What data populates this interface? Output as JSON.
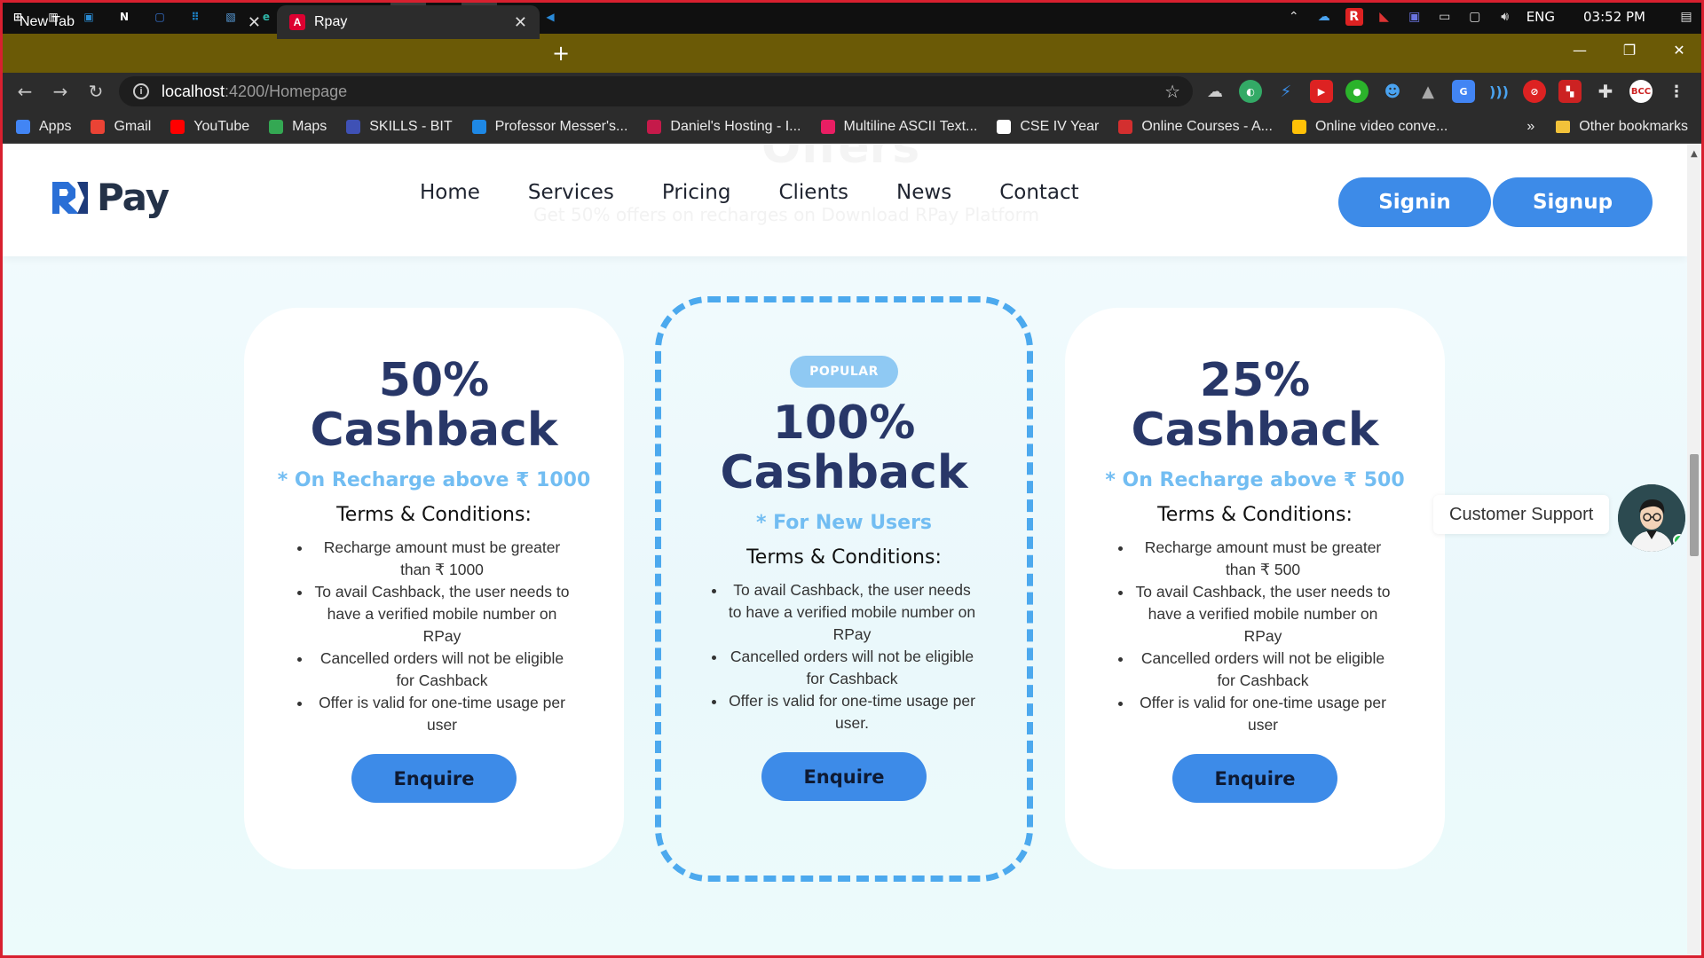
{
  "taskbar": {
    "apps": [
      {
        "name": "windows-start-icon",
        "glyph": "⊞",
        "color": "#ffffff"
      },
      {
        "name": "task-view-icon",
        "glyph": "▥",
        "color": "#ffffff"
      },
      {
        "name": "app-icon-1",
        "glyph": "▣",
        "color": "#2a8cd4"
      },
      {
        "name": "app-icon-2",
        "glyph": "N",
        "color": "#ffffff"
      },
      {
        "name": "app-icon-3",
        "glyph": "▢",
        "color": "#3a7be0"
      },
      {
        "name": "app-icon-4",
        "glyph": "⠿",
        "color": "#1c7ec0"
      },
      {
        "name": "photos-icon",
        "glyph": "▧",
        "color": "#5aa1e0"
      },
      {
        "name": "edge-icon",
        "glyph": "e",
        "color": "#2fb5a8"
      },
      {
        "name": "app-icon-5",
        "glyph": "◣",
        "color": "#d33"
      },
      {
        "name": "visual-studio-icon",
        "glyph": "◆",
        "color": "#8a52c8"
      },
      {
        "name": "file-explorer-icon",
        "glyph": "▬",
        "color": "#f2c23a"
      },
      {
        "name": "teams-icon",
        "glyph": "T",
        "color": "#5059c9"
      },
      {
        "name": "visual-studio-icon-2",
        "glyph": "◆",
        "color": "#8a52c8"
      },
      {
        "name": "chrome-icon",
        "glyph": "●",
        "color": "#f4b400"
      },
      {
        "name": "photoshop-icon",
        "glyph": "Ps",
        "color": "#1b3b5a"
      },
      {
        "name": "vscode-icon",
        "glyph": "◀",
        "color": "#2a8ad8"
      }
    ],
    "tray": {
      "language": "ENG",
      "time": "03:52 PM"
    }
  },
  "browser": {
    "tabs": [
      {
        "label": "New Tab"
      },
      {
        "label": "Rpay"
      }
    ],
    "url_host": "localhost",
    "url_path": ":4200/Homepage",
    "bookmarks": [
      {
        "label": "Apps",
        "icon": "apps-grid-icon",
        "color": "#4285f4"
      },
      {
        "label": "Gmail",
        "icon": "gmail-icon",
        "color": "#ea4335"
      },
      {
        "label": "YouTube",
        "icon": "youtube-icon",
        "color": "#ff0000"
      },
      {
        "label": "Maps",
        "icon": "maps-icon",
        "color": "#34a853"
      },
      {
        "label": "SKILLS - BIT",
        "icon": "skills-icon",
        "color": "#3f51b5"
      },
      {
        "label": "Professor Messer's...",
        "icon": "professor-messer-icon",
        "color": "#1e88e5"
      },
      {
        "label": "Daniel's Hosting - I...",
        "icon": "raspberry-icon",
        "color": "#c51a4a"
      },
      {
        "label": "Multiline ASCII Text...",
        "icon": "ascii-icon",
        "color": "#e91e63"
      },
      {
        "label": "CSE IV Year",
        "icon": "google-icon",
        "color": "#ffffff"
      },
      {
        "label": "Online Courses - A...",
        "icon": "courses-icon",
        "color": "#d32f2f"
      },
      {
        "label": "Online video conve...",
        "icon": "video-convert-icon",
        "color": "#ffc107"
      }
    ],
    "other_bookmarks": "Other bookmarks"
  },
  "site": {
    "logo_text": "Pay",
    "ghost_title": "Offers",
    "ghost_subtitle": "Get 50% offers on recharges on Download RPay Platform",
    "nav": [
      "Home",
      "Services",
      "Pricing",
      "Clients",
      "News",
      "Contact"
    ],
    "signin": "Signin",
    "signup": "Signup",
    "brand_color": "#3d8be8"
  },
  "offers": [
    {
      "percent": "50%",
      "title": "Cashback",
      "condition": "* On Recharge above ₹ 1000",
      "terms_heading": "Terms & Conditions:",
      "terms": [
        "Recharge amount must be greater than ₹ 1000",
        "To avail Cashback, the user needs to have a verified mobile number on RPay",
        "Cancelled orders will not be eligible for Cashback",
        "Offer is valid for one-time usage per user"
      ],
      "button": "Enquire"
    },
    {
      "badge": "POPULAR",
      "percent": "100%",
      "title": "Cashback",
      "condition": "* For New Users",
      "terms_heading": "Terms & Conditions:",
      "terms": [
        "To avail Cashback, the user needs to have a verified mobile number on RPay",
        "Cancelled orders will not be eligible for Cashback",
        "Offer is valid for one-time usage per user."
      ],
      "button": "Enquire"
    },
    {
      "percent": "25%",
      "title": "Cashback",
      "condition": "* On Recharge above ₹ 500",
      "terms_heading": "Terms & Conditions:",
      "terms": [
        "Recharge amount must be greater than ₹ 500",
        "To avail Cashback, the user needs to have a verified mobile number on RPay",
        "Cancelled orders will not be eligible for Cashback",
        "Offer is valid for one-time usage per user"
      ],
      "button": "Enquire"
    }
  ],
  "support": {
    "label": "Customer Support"
  }
}
